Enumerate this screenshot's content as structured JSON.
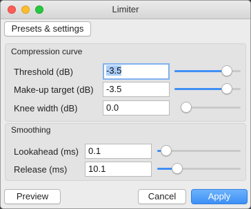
{
  "window": {
    "title": "Limiter"
  },
  "toolbar": {
    "presets_label": "Presets & settings"
  },
  "compression": {
    "title": "Compression curve",
    "threshold": {
      "label": "Threshold (dB)",
      "value": "-3.5",
      "slider": 0.85
    },
    "makeup": {
      "label": "Make-up target (dB)",
      "value": "-3.5",
      "slider": 0.85
    },
    "knee": {
      "label": "Knee width (dB)",
      "value": "0.0",
      "slider": 0.0
    }
  },
  "smoothing": {
    "title": "Smoothing",
    "lookahead": {
      "label": "Lookahead (ms)",
      "value": "0.1",
      "slider": 0.05
    },
    "release": {
      "label": "Release (ms)",
      "value": "10.1",
      "slider": 0.2
    }
  },
  "footer": {
    "preview_label": "Preview",
    "cancel_label": "Cancel",
    "apply_label": "Apply"
  },
  "colors": {
    "accent": "#3f8ff5",
    "selection": "#a9cdf8"
  }
}
